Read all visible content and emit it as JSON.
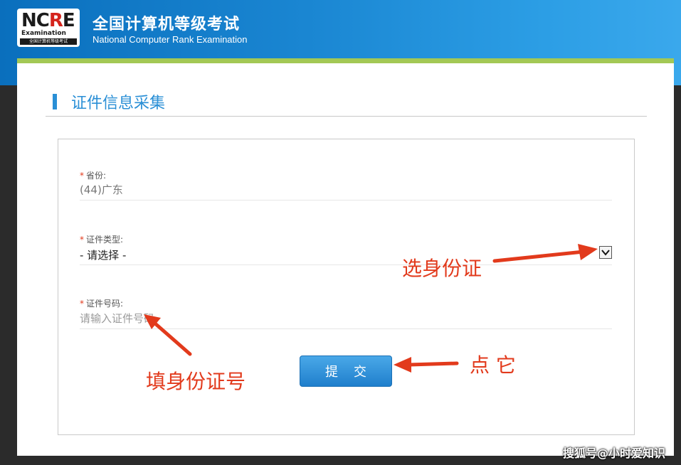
{
  "header": {
    "logo_text": "NCRE",
    "logo_sub": "Examination",
    "logo_bar": "全国计算机等级考试",
    "title": "全国计算机等级考试",
    "subtitle": "National Computer Rank Examination"
  },
  "colors": {
    "header_blue": "#1a86d2",
    "accent_green": "#a3c855",
    "title_blue": "#2a8fd6",
    "required_red": "#e23a1c",
    "button_blue": "#2a8ad6",
    "annotation_red": "#e23a1c"
  },
  "section": {
    "title": "证件信息采集"
  },
  "form": {
    "province": {
      "required_mark": "*",
      "label": "省份:",
      "value": "(44)广东"
    },
    "id_type": {
      "required_mark": "*",
      "label": "证件类型:",
      "selected": "- 请选择 -",
      "arrow_icon": "chevron-down-icon"
    },
    "id_number": {
      "required_mark": "*",
      "label": "证件号码:",
      "placeholder": "请输入证件号码",
      "value": ""
    },
    "submit_label": "提交"
  },
  "annotations": {
    "select_id": "选身份证",
    "fill_id": "填身份证号",
    "click_it": "点 它"
  },
  "watermark": "搜狐号@小时爱知识"
}
